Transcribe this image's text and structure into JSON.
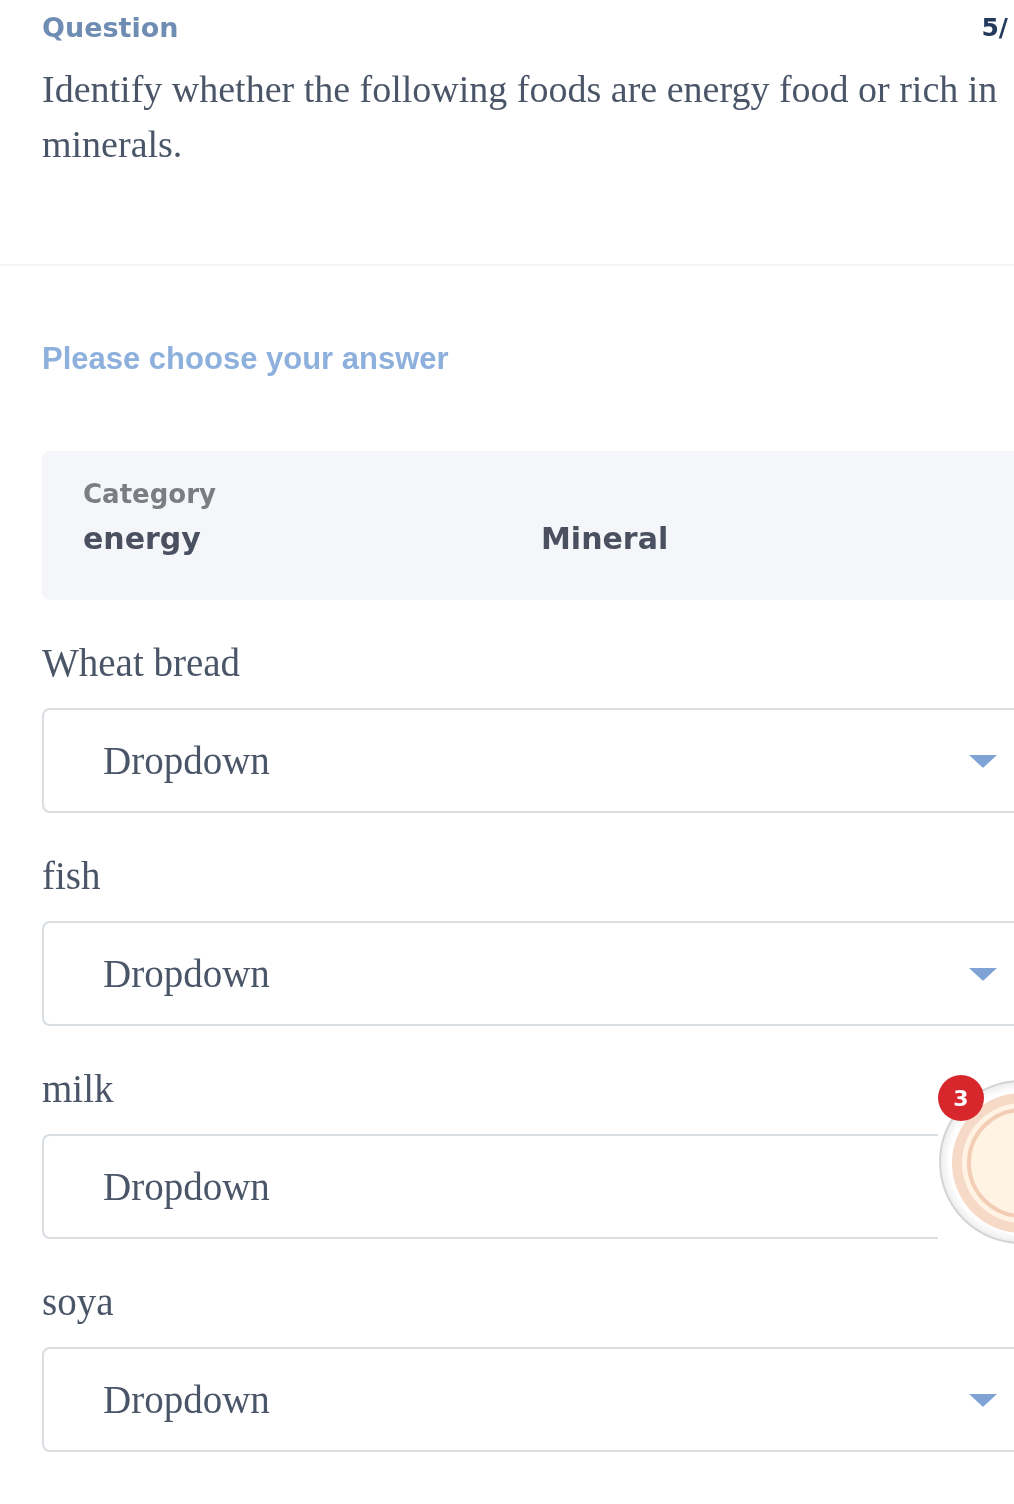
{
  "header": {
    "title": "Question",
    "progress": "5/"
  },
  "question": "Identify whether the following foods are energy food or rich in minerals.",
  "instruction": "Please choose your answer",
  "category_table": {
    "title": "Category",
    "columns": [
      "energy",
      "Mineral"
    ]
  },
  "items": [
    {
      "label": "Wheat bread",
      "value": "Dropdown"
    },
    {
      "label": "fish",
      "value": "Dropdown"
    },
    {
      "label": "milk",
      "value": "Dropdown",
      "floating_bubble": {
        "badge": "3"
      }
    },
    {
      "label": "soya",
      "value": "Dropdown"
    }
  ]
}
